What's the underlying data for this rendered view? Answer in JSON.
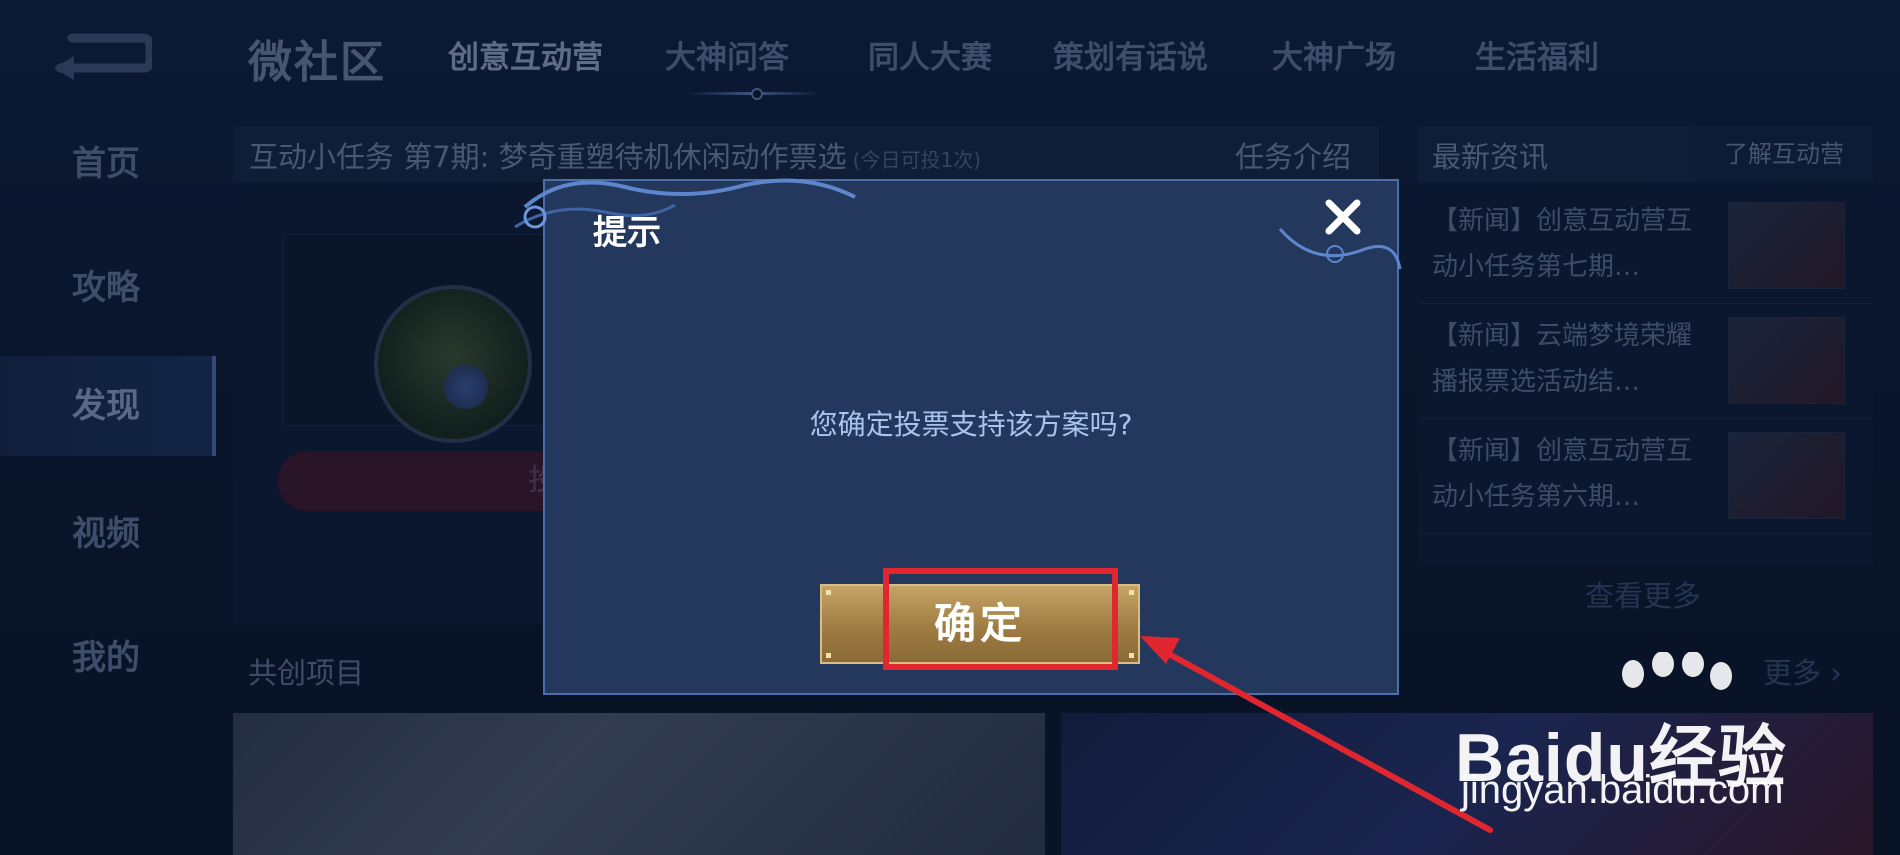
{
  "nav": {
    "brand": "微社区",
    "tabs": [
      "创意互动营",
      "大神问答",
      "同人大赛",
      "策划有话说",
      "大神广场",
      "生活福利"
    ],
    "active_tab": "创意互动营"
  },
  "sidebar": {
    "items": [
      "首页",
      "攻略",
      "发现",
      "视频",
      "我的"
    ],
    "active": "发现"
  },
  "task": {
    "title": "互动小任务 第7期: 梦奇重塑待机休闲动作票选",
    "note": "(今日可投1次)",
    "intro_label": "任务介绍",
    "vote_button": "投票"
  },
  "news": {
    "title": "最新资讯",
    "more_label": "了解互动营",
    "items": [
      {
        "text": "【新闻】创意互动营互动小任务第七期…"
      },
      {
        "text": "【新闻】云端梦境荣耀播报票选活动结…"
      },
      {
        "text": "【新闻】创意互动营互动小任务第六期…"
      }
    ],
    "view_more": "查看更多"
  },
  "cocreate": {
    "title": "共创项目",
    "more_label": "更多"
  },
  "dialog": {
    "title": "提示",
    "message": "您确定投票支持该方案吗?",
    "confirm_label": "确定"
  },
  "watermark": {
    "brand": "Baidu经验",
    "url": "jingyan.baidu.com"
  },
  "colors": {
    "background": "#0f1c33",
    "dialog": "#24385d",
    "confirm_gold": "#b8965a",
    "annotation_red": "#e0262f"
  }
}
